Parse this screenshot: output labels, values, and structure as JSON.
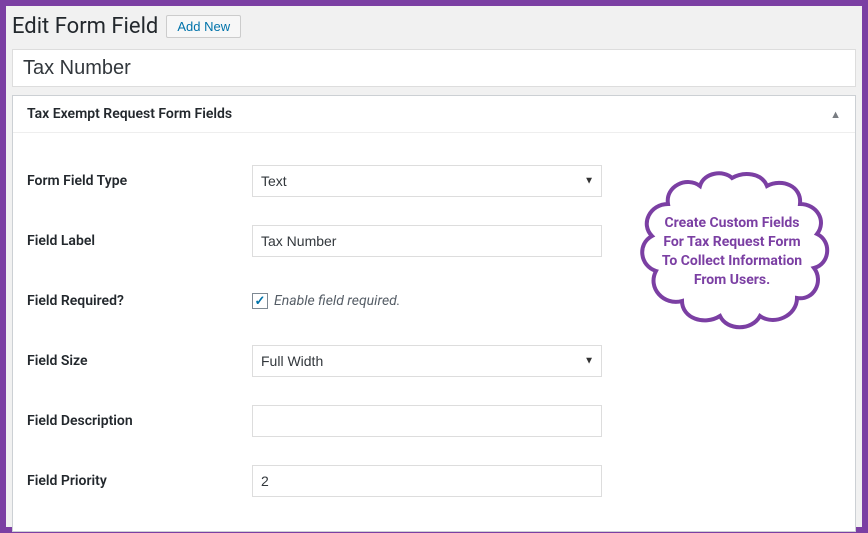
{
  "header": {
    "page_title": "Edit Form Field",
    "add_new_label": "Add New"
  },
  "title_field": {
    "value": "Tax Number"
  },
  "metabox": {
    "title": "Tax Exempt Request Form Fields"
  },
  "form": {
    "field_type": {
      "label": "Form Field Type",
      "value": "Text"
    },
    "field_label": {
      "label": "Field Label",
      "value": "Tax Number"
    },
    "field_required": {
      "label": "Field Required?",
      "checkbox_label": "Enable field required.",
      "checked": true
    },
    "field_size": {
      "label": "Field Size",
      "value": "Full Width"
    },
    "field_description": {
      "label": "Field Description",
      "value": ""
    },
    "field_priority": {
      "label": "Field Priority",
      "value": "2"
    }
  },
  "callout": {
    "line1": "Create Custom Fields",
    "line2": "For Tax Request Form",
    "line3": "To Collect Information",
    "line4": "From Users."
  }
}
